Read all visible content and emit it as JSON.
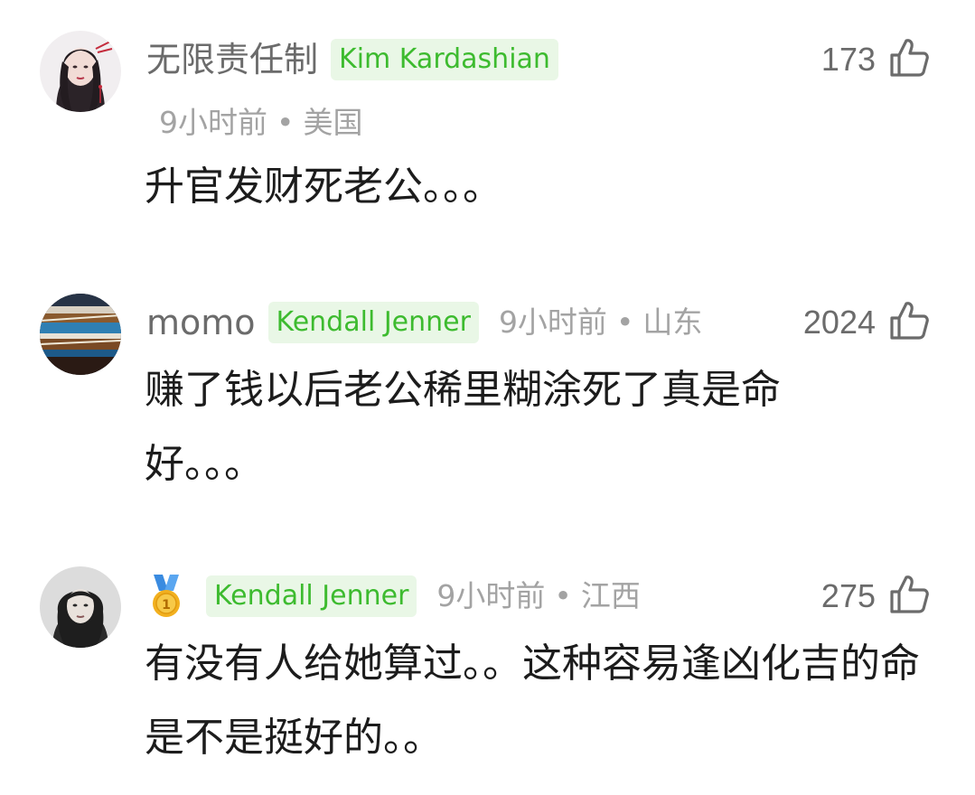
{
  "comments": [
    {
      "username": "无限责任制",
      "tag": "Kim Kardashian",
      "time": "9小时前",
      "location": "美国",
      "likes": "173",
      "text": "升官发财死老公。。。",
      "avatar_icon": "woman-portrait-avatar"
    },
    {
      "username": "momo",
      "tag": "Kendall Jenner",
      "time": "9小时前",
      "location": "山东",
      "likes": "2024",
      "text": "赚了钱以后老公稀里糊涂死了真是命好。。。",
      "avatar_icon": "abstract-stripes-avatar"
    },
    {
      "username": "",
      "badge_icon": "gold-medal-icon",
      "tag": "Kendall Jenner",
      "time": "9小时前",
      "location": "江西",
      "likes": "275",
      "text": "有没有人给她算过。。这种容易逢凶化吉的命是不是挺好的。。",
      "avatar_icon": "woman-photo-avatar"
    }
  ],
  "colors": {
    "tag_bg": "#e9f7e6",
    "tag_text": "#3dbb2f",
    "meta_text": "#a3a3a3",
    "username_text": "#6b6b6b",
    "body_text": "#1c1c1c"
  }
}
